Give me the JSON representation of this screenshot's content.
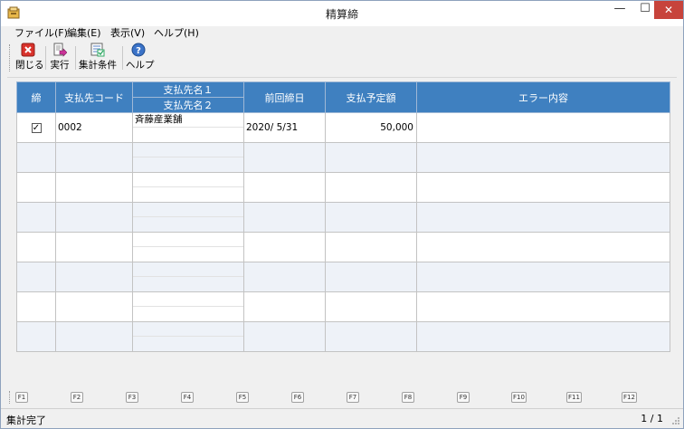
{
  "window": {
    "title": "精算締",
    "min_glyph": "—",
    "max_glyph": "☐",
    "close_glyph": "✕"
  },
  "menu": {
    "items": [
      {
        "label": "ファイル(F)"
      },
      {
        "label": "編集(E)"
      },
      {
        "label": "表示(V)"
      },
      {
        "label": "ヘルプ(H)"
      }
    ]
  },
  "toolbar": {
    "close_label": "閉じる",
    "run_label": "実行",
    "criteria_label": "集計条件",
    "help_label": "ヘルプ"
  },
  "grid": {
    "headers": {
      "close_flag": "締",
      "payee_code": "支払先コード",
      "payee_name1": "支払先名１",
      "payee_name2": "支払先名２",
      "last_close_date": "前回締日",
      "planned_amount": "支払予定額",
      "error": "エラー内容"
    },
    "rows": [
      {
        "checked": "✓",
        "code": "0002",
        "name1": "斉藤産業舗",
        "name2": "",
        "date": "2020/ 5/31",
        "amount": "50,000",
        "error": ""
      }
    ]
  },
  "fkeys": [
    "F1",
    "F2",
    "F3",
    "F4",
    "F5",
    "F6",
    "F7",
    "F8",
    "F9",
    "F10",
    "F11",
    "F12"
  ],
  "status": {
    "message": "集計完了",
    "page": "1 / 1"
  },
  "colors": {
    "header": "#3f80c0",
    "close_button": "#c7433b",
    "alt_row": "#eef2f8"
  }
}
